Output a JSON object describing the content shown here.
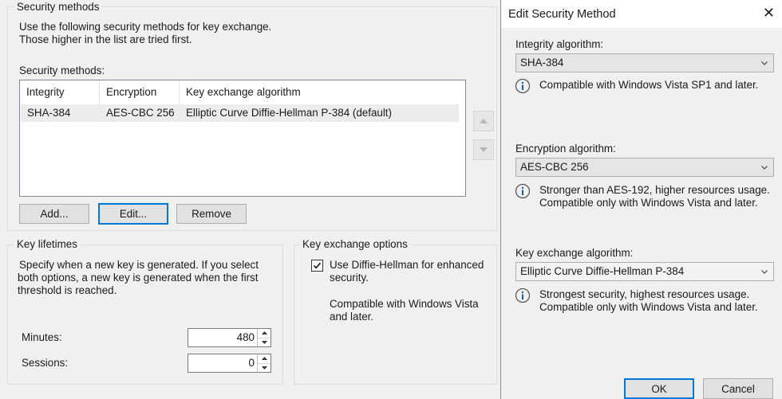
{
  "security_methods_group": {
    "title": "Security methods",
    "desc_line1": "Use the following security methods for key exchange.",
    "desc_line2": "Those higher in the list are tried first.",
    "list_label": "Security methods:",
    "columns": [
      "Integrity",
      "Encryption",
      "Key exchange algorithm"
    ],
    "rows": [
      {
        "integrity": "SHA-384",
        "encryption": "AES-CBC 256",
        "key_exchange": "Elliptic Curve Diffie-Hellman P-384 (default)"
      }
    ],
    "add_label": "Add...",
    "edit_label": "Edit...",
    "remove_label": "Remove",
    "move_up_icon": "triangle-up",
    "move_down_icon": "triangle-down"
  },
  "key_lifetimes": {
    "title": "Key lifetimes",
    "desc_line1": "Specify when a new key is generated. If you select",
    "desc_line2": "both options, a new key is generated when the first",
    "desc_line3": "threshold is reached.",
    "minutes_label": "Minutes:",
    "minutes_value": "480",
    "sessions_label": "Sessions:",
    "sessions_value": "0"
  },
  "key_exchange_options": {
    "title": "Key exchange options",
    "checkbox_checked": true,
    "checkbox_line1": "Use Diffie-Hellman for enhanced",
    "checkbox_line2": "security.",
    "compat_line1": "Compatible with Windows Vista",
    "compat_line2": "and later."
  },
  "dialog": {
    "title": "Edit Security Method",
    "close_glyph": "✕",
    "integrity_label": "Integrity algorithm:",
    "integrity_value": "SHA-384",
    "integrity_info": "Compatible with Windows Vista SP1 and later.",
    "encryption_label": "Encryption algorithm:",
    "encryption_value": "AES-CBC 256",
    "encryption_info_line1": "Stronger than AES-192, higher resources usage.",
    "encryption_info_line2": "Compatible only with Windows Vista and later.",
    "keyexchange_label": "Key exchange algorithm:",
    "keyexchange_value": "Elliptic Curve Diffie-Hellman P-384",
    "keyexchange_info_line1": "Strongest security, highest resources usage.",
    "keyexchange_info_line2": "Compatible only with Windows Vista and later.",
    "ok_label": "OK",
    "cancel_label": "Cancel"
  },
  "colors": {
    "focus_blue": "#0078d7",
    "info_icon_blue": "#1e5a9a"
  }
}
